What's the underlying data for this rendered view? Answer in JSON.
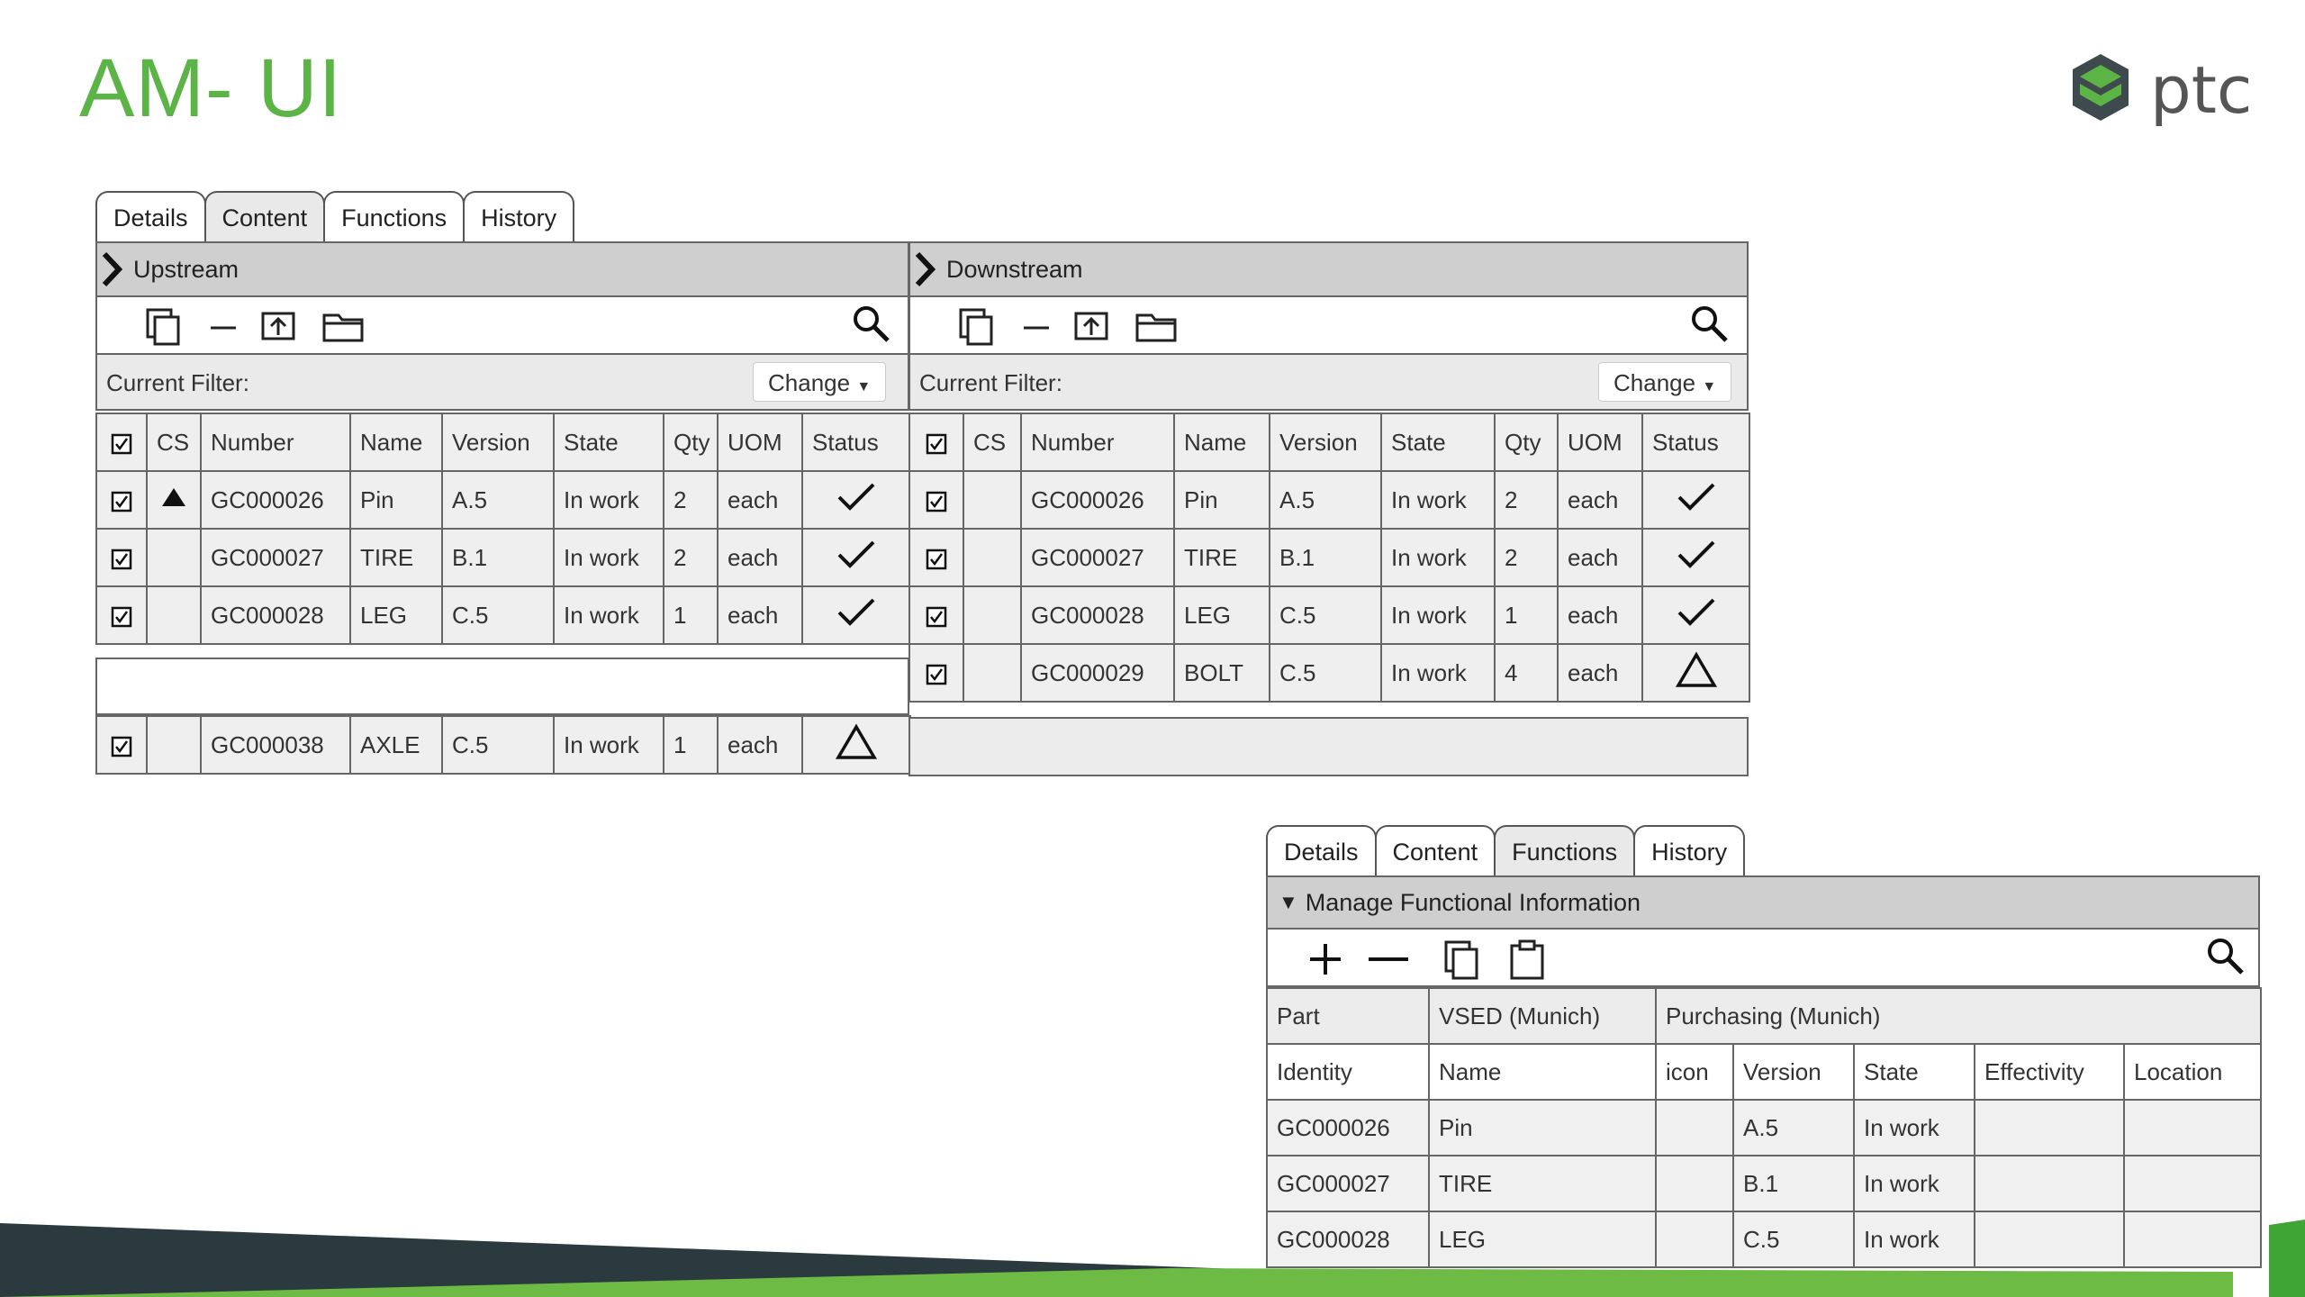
{
  "slide": {
    "title": "AM- UI",
    "logo_text": "ptc",
    "colors": {
      "title": "#5cb346",
      "logo_green": "#5cb346",
      "footer_dark": "#2b3a3f",
      "footer_green": "#6dbb45"
    }
  },
  "tabs_top": {
    "items": [
      "Details",
      "Content",
      "Functions",
      "History"
    ],
    "active": "Content"
  },
  "upstream": {
    "title": "Upstream",
    "filter_label": "Current Filter:",
    "change_label": "Change",
    "columns": [
      "CS",
      "Number",
      "Name",
      "Version",
      "State",
      "Qty",
      "UOM",
      "Status"
    ],
    "rows": [
      {
        "cs": "triangle-filled",
        "number": "GC000026",
        "name": "Pin",
        "version": "A.5",
        "state": "In work",
        "qty": "2",
        "uom": "each",
        "status": "check"
      },
      {
        "cs": "",
        "number": "GC000027",
        "name": "TIRE",
        "version": "B.1",
        "state": "In work",
        "qty": "2",
        "uom": "each",
        "status": "check"
      },
      {
        "cs": "",
        "number": "GC000028",
        "name": "LEG",
        "version": "C.5",
        "state": "In work",
        "qty": "1",
        "uom": "each",
        "status": "check"
      },
      {
        "cs": "",
        "number": "GC000038",
        "name": "AXLE",
        "version": "C.5",
        "state": "In work",
        "qty": "1",
        "uom": "each",
        "status": "triangle-outline"
      }
    ]
  },
  "downstream": {
    "title": "Downstream",
    "filter_label": "Current Filter:",
    "change_label": "Change",
    "columns": [
      "CS",
      "Number",
      "Name",
      "Version",
      "State",
      "Qty",
      "UOM",
      "Status"
    ],
    "rows": [
      {
        "cs": "",
        "number": "GC000026",
        "name": "Pin",
        "version": "A.5",
        "state": "In work",
        "qty": "2",
        "uom": "each",
        "status": "check"
      },
      {
        "cs": "",
        "number": "GC000027",
        "name": "TIRE",
        "version": "B.1",
        "state": "In work",
        "qty": "2",
        "uom": "each",
        "status": "check"
      },
      {
        "cs": "",
        "number": "GC000028",
        "name": "LEG",
        "version": "C.5",
        "state": "In work",
        "qty": "1",
        "uom": "each",
        "status": "check"
      },
      {
        "cs": "",
        "number": "GC000029",
        "name": "BOLT",
        "version": "C.5",
        "state": "In work",
        "qty": "4",
        "uom": "each",
        "status": "triangle-outline"
      }
    ]
  },
  "tabs_bottom": {
    "items": [
      "Details",
      "Content",
      "Functions",
      "History"
    ],
    "active": "Functions"
  },
  "functional": {
    "title": "Manage Functional Information",
    "group_headers": [
      "Part",
      "VSED (Munich)",
      "Purchasing (Munich)"
    ],
    "columns": [
      "Identity",
      "Name",
      "icon",
      "Version",
      "State",
      "Effectivity",
      "Location"
    ],
    "rows": [
      {
        "identity": "GC000026",
        "name": "Pin",
        "icon": "",
        "version": "A.5",
        "state": "In work",
        "effectivity": "",
        "location": ""
      },
      {
        "identity": "GC000027",
        "name": "TIRE",
        "icon": "",
        "version": "B.1",
        "state": "In work",
        "effectivity": "",
        "location": ""
      },
      {
        "identity": "GC000028",
        "name": "LEG",
        "icon": "",
        "version": "C.5",
        "state": "In work",
        "effectivity": "",
        "location": ""
      }
    ]
  }
}
